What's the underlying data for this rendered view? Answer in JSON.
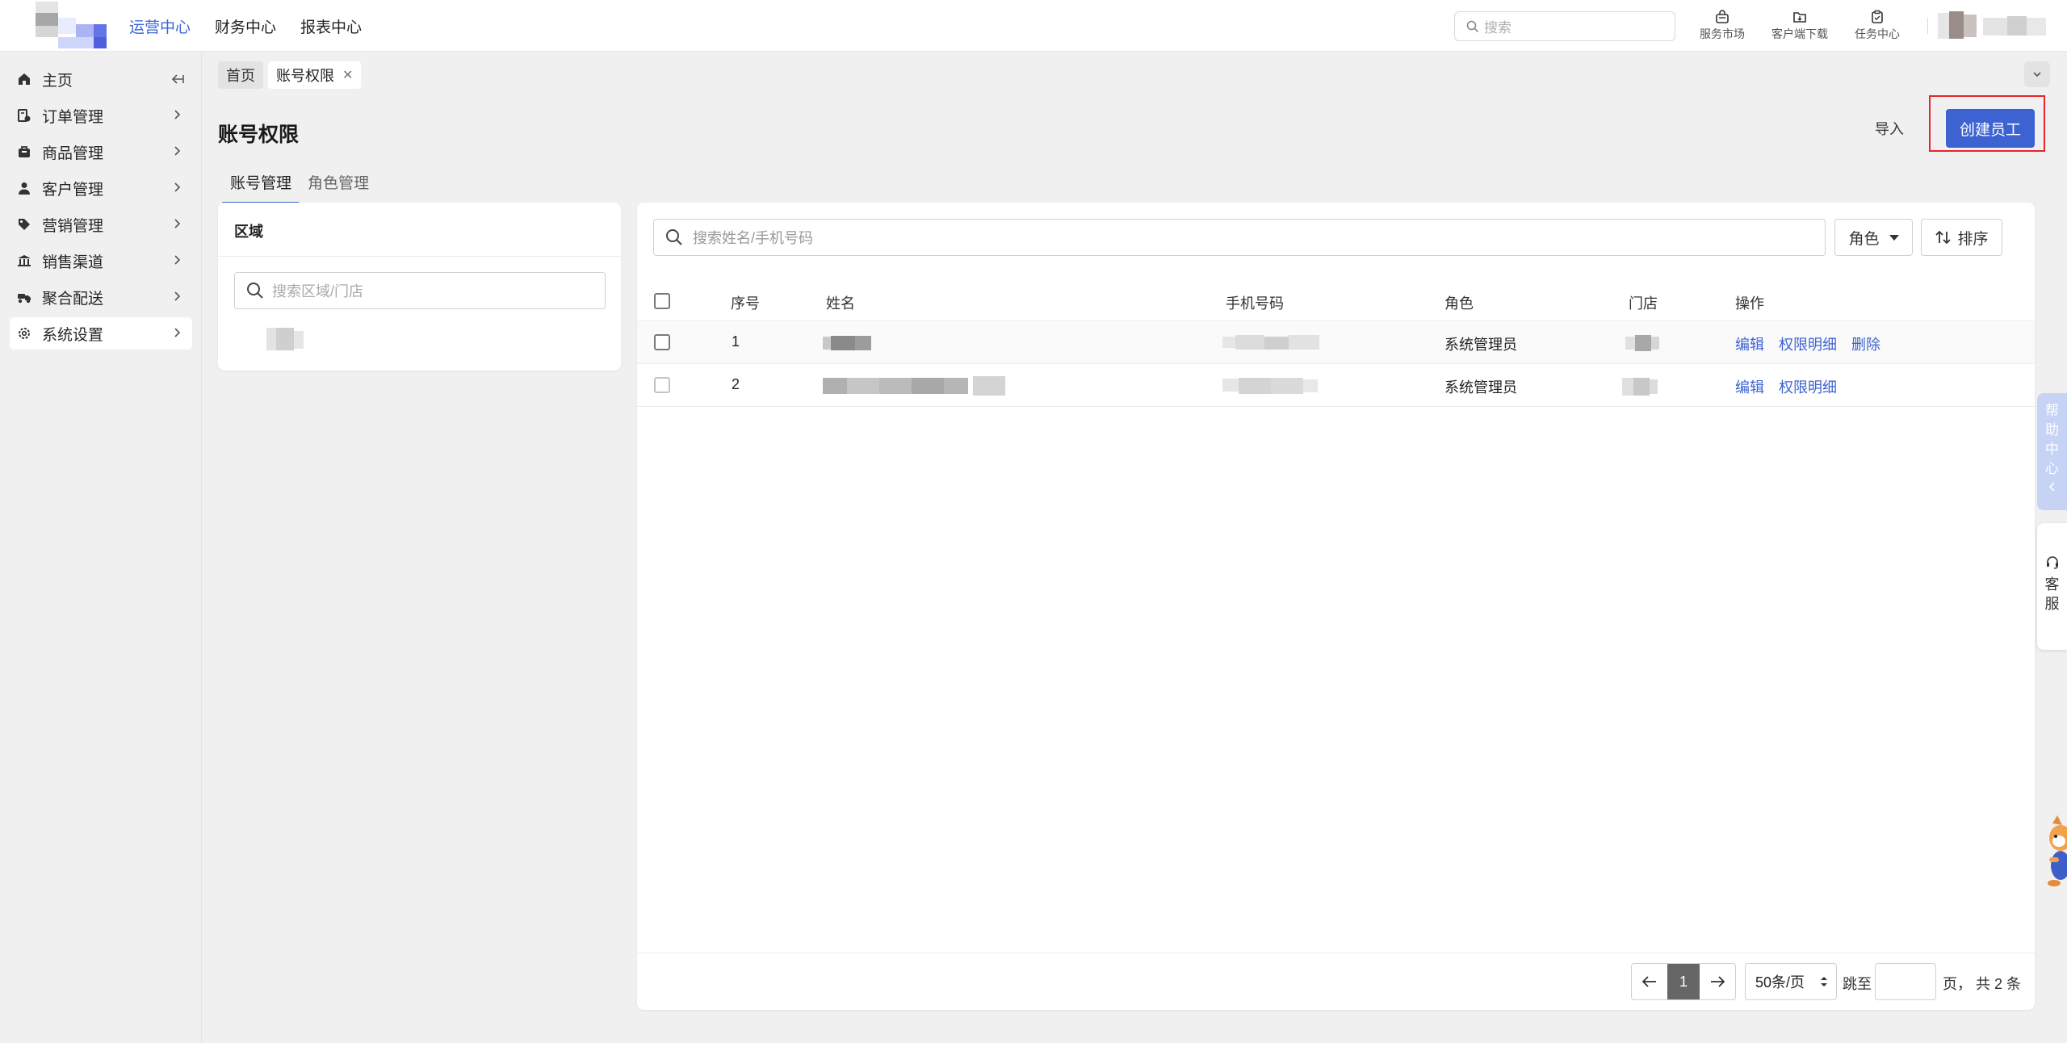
{
  "topbar": {
    "nav": [
      "运营中心",
      "财务中心",
      "报表中心"
    ],
    "search_placeholder": "搜索",
    "tools": [
      "服务市场",
      "客户端下载",
      "任务中心"
    ]
  },
  "sidebar": {
    "items": [
      {
        "label": "主页",
        "icon": "home-icon"
      },
      {
        "label": "订单管理",
        "icon": "order-icon"
      },
      {
        "label": "商品管理",
        "icon": "goods-icon"
      },
      {
        "label": "客户管理",
        "icon": "user-icon"
      },
      {
        "label": "营销管理",
        "icon": "tag-icon"
      },
      {
        "label": "销售渠道",
        "icon": "bank-icon"
      },
      {
        "label": "聚合配送",
        "icon": "delivery-icon"
      },
      {
        "label": "系统设置",
        "icon": "gear-icon"
      }
    ]
  },
  "tabs": {
    "home": "首页",
    "current": "账号权限"
  },
  "page": {
    "title": "账号权限",
    "import": "导入",
    "create": "创建员工",
    "subtabs": [
      "账号管理",
      "角色管理"
    ]
  },
  "region": {
    "title": "区域",
    "search_placeholder": "搜索区域/门店"
  },
  "table": {
    "search_placeholder": "搜索姓名/手机号码",
    "role_filter": "角色",
    "sort": "排序",
    "headers": [
      "序号",
      "姓名",
      "手机号码",
      "角色",
      "门店",
      "操作"
    ],
    "rows": [
      {
        "index": "1",
        "role": "系统管理员",
        "actions": [
          "编辑",
          "权限明细",
          "删除"
        ]
      },
      {
        "index": "2",
        "role": "系统管理员",
        "actions": [
          "编辑",
          "权限明细"
        ]
      }
    ]
  },
  "pager": {
    "current": "1",
    "page_size": "50条/页",
    "jump": "跳至",
    "total": "页， 共 2 条"
  },
  "float": {
    "help": [
      "帮",
      "助",
      "中",
      "心"
    ],
    "service": [
      "客",
      "服"
    ]
  }
}
